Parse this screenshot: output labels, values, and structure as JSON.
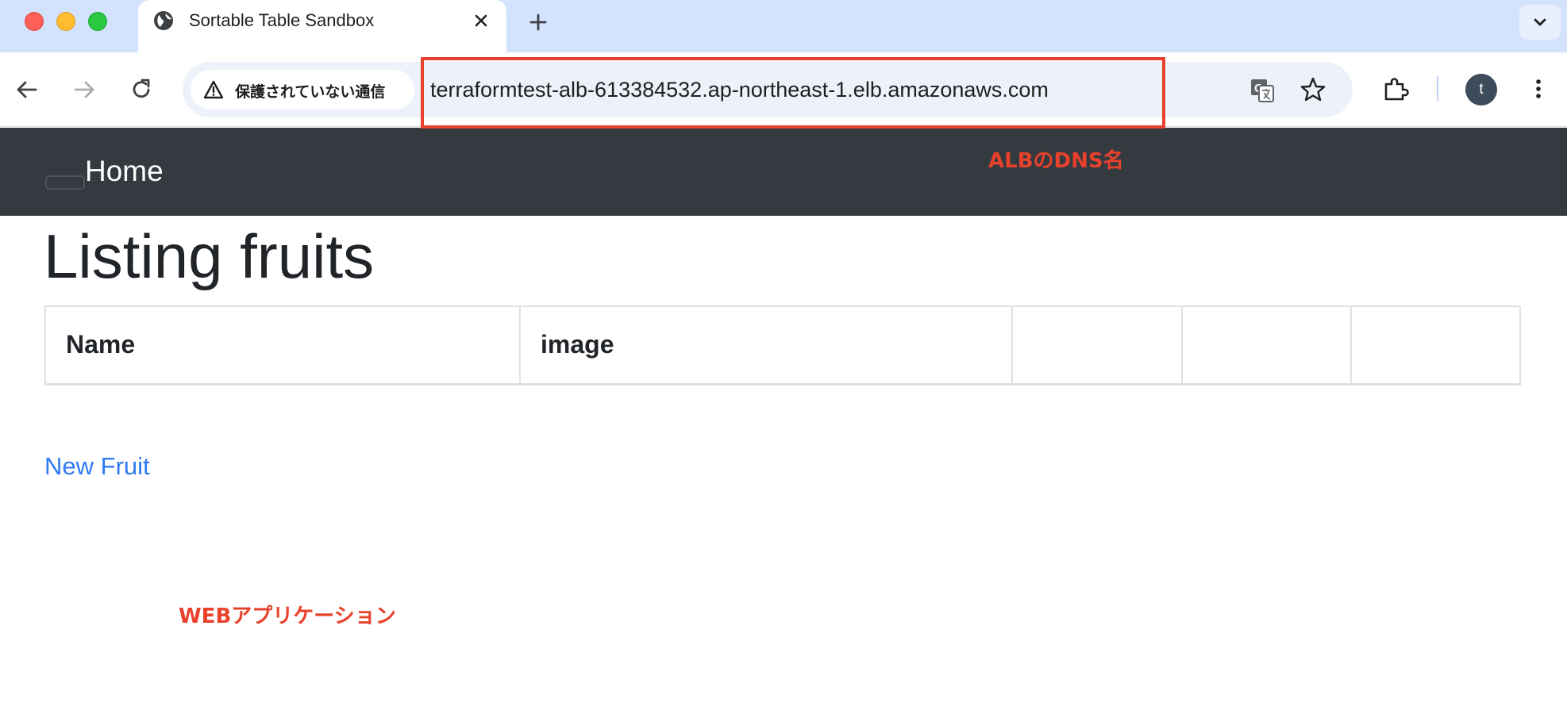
{
  "browser": {
    "tab_title": "Sortable Table Sandbox",
    "security_label": "保護されていない通信",
    "url": "terraformtest-alb-613384532.ap-northeast-1.elb.amazonaws.com",
    "profile_initial": "t",
    "icons": [
      "globe-icon",
      "close-icon",
      "plus-icon",
      "chevron-down-icon",
      "back-arrow-icon",
      "forward-arrow-icon",
      "reload-icon",
      "warning-icon",
      "translate-icon",
      "star-icon",
      "extensions-icon",
      "more-vertical-icon"
    ]
  },
  "annotations": {
    "url_label": "ALBのDNS名",
    "app_label": "WEBアプリケーション",
    "color": "#e8412c"
  },
  "navbar": {
    "brand": "Home"
  },
  "page": {
    "heading": "Listing fruits",
    "table_headers": [
      "Name",
      "image",
      "",
      "",
      ""
    ],
    "new_link": "New Fruit"
  }
}
